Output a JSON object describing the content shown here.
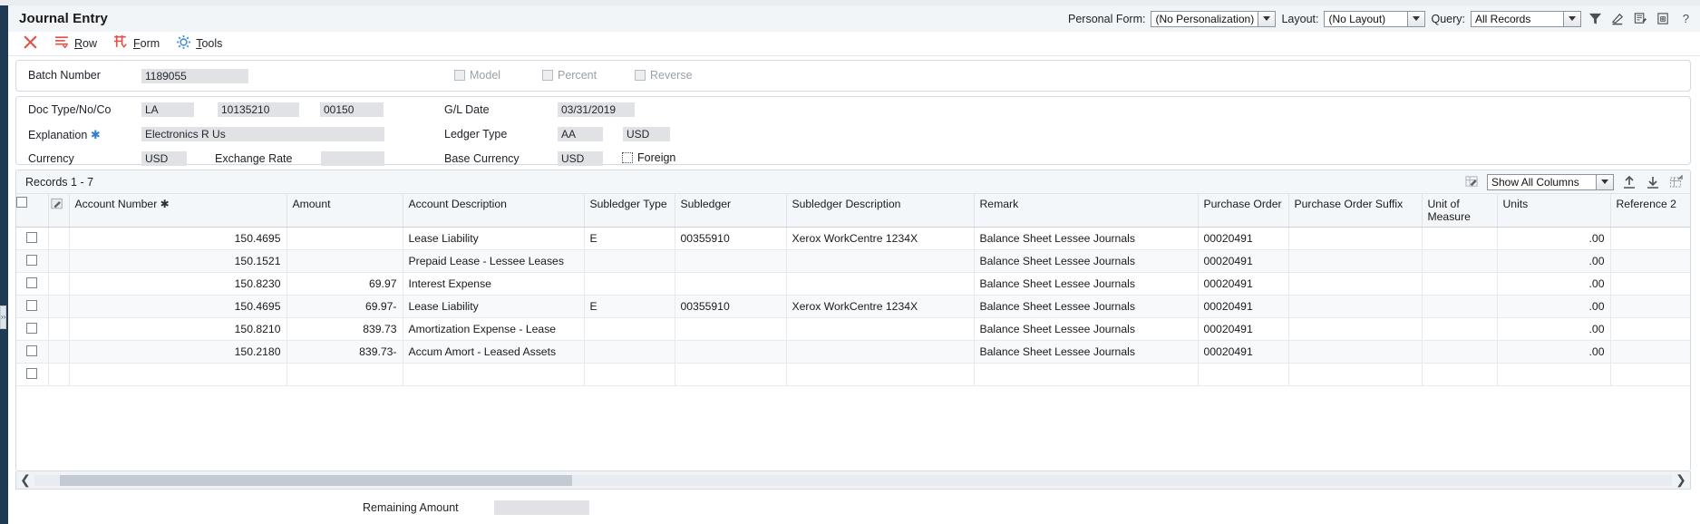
{
  "window": {
    "title": "Journal Entry"
  },
  "toolbar_right": {
    "personal_form_label": "Personal Form:",
    "personal_form_value": "(No Personalization)",
    "layout_label": "Layout:",
    "layout_value": "(No Layout)",
    "query_label": "Query:",
    "query_value": "All Records",
    "icons": [
      "filter-icon",
      "highlighter-icon",
      "form-edit-icon",
      "save-form-icon",
      "help-icon"
    ]
  },
  "actions": [
    {
      "name": "close-action",
      "label": "",
      "icon": "close-x-icon"
    },
    {
      "name": "row-action",
      "label": "Row",
      "accel": "R",
      "icon": "row-menu-icon"
    },
    {
      "name": "form-action",
      "label": "Form",
      "accel": "F",
      "icon": "form-menu-icon"
    },
    {
      "name": "tools-action",
      "label": "Tools",
      "accel": "T",
      "icon": "gear-icon"
    }
  ],
  "batch_panel": {
    "batch_number_label": "Batch Number",
    "batch_number_value": "1189055",
    "model_label": "Model",
    "percent_label": "Percent",
    "reverse_label": "Reverse"
  },
  "header_panel": {
    "doc_type_label": "Doc Type/No/Co",
    "doc_type_value": "LA",
    "doc_no_value": "10135210",
    "doc_co_value": "00150",
    "explanation_label": "Explanation",
    "explanation_value": "Electronics R Us",
    "currency_label": "Currency",
    "currency_value": "USD",
    "exchange_rate_label": "Exchange Rate",
    "exchange_rate_value": "",
    "gl_date_label": "G/L Date",
    "gl_date_value": "03/31/2019",
    "ledger_type_label": "Ledger Type",
    "ledger_type_value": "AA",
    "ledger_currency_value": "USD",
    "base_currency_label": "Base Currency",
    "base_currency_value": "USD",
    "foreign_label": "Foreign"
  },
  "grid": {
    "records_label": "Records 1 - 7",
    "show_columns_value": "Show All Columns",
    "toolbar_icons": [
      "grid-highlighter-icon",
      "upload-icon",
      "download-icon",
      "expand-grid-icon"
    ],
    "columns": [
      {
        "key": "checkbox",
        "label": ""
      },
      {
        "key": "pencil",
        "label": ""
      },
      {
        "key": "account_number",
        "label": "Account Number",
        "required": true
      },
      {
        "key": "amount",
        "label": "Amount"
      },
      {
        "key": "account_description",
        "label": "Account Description"
      },
      {
        "key": "subledger_type",
        "label": "Subledger Type"
      },
      {
        "key": "subledger",
        "label": "Subledger"
      },
      {
        "key": "subledger_description",
        "label": "Subledger Description"
      },
      {
        "key": "remark",
        "label": "Remark"
      },
      {
        "key": "purchase_order",
        "label": "Purchase Order"
      },
      {
        "key": "purchase_order_suffix",
        "label": "Purchase Order Suffix"
      },
      {
        "key": "unit_of_measure",
        "label": "Unit of Measure"
      },
      {
        "key": "units",
        "label": "Units"
      },
      {
        "key": "reference_2",
        "label": "Reference 2"
      }
    ],
    "rows": [
      {
        "account_number": "150.4695",
        "amount": "",
        "account_description": "Lease Liability",
        "subledger_type": "E",
        "subledger": "00355910",
        "subledger_description": "Xerox WorkCentre 1234X",
        "remark": "Balance Sheet Lessee Journals",
        "purchase_order": "00020491",
        "purchase_order_suffix": "",
        "unit_of_measure": "",
        "units": ".00",
        "reference_2": ""
      },
      {
        "account_number": "150.1521",
        "amount": "",
        "account_description": "Prepaid Lease - Lessee Leases",
        "subledger_type": "",
        "subledger": "",
        "subledger_description": "",
        "remark": "Balance Sheet Lessee Journals",
        "purchase_order": "00020491",
        "purchase_order_suffix": "",
        "unit_of_measure": "",
        "units": ".00",
        "reference_2": ""
      },
      {
        "account_number": "150.8230",
        "amount": "69.97",
        "account_description": "Interest Expense",
        "subledger_type": "",
        "subledger": "",
        "subledger_description": "",
        "remark": "Balance Sheet Lessee Journals",
        "purchase_order": "00020491",
        "purchase_order_suffix": "",
        "unit_of_measure": "",
        "units": ".00",
        "reference_2": ""
      },
      {
        "account_number": "150.4695",
        "amount": "69.97-",
        "account_description": "Lease Liability",
        "subledger_type": "E",
        "subledger": "00355910",
        "subledger_description": "Xerox WorkCentre 1234X",
        "remark": "Balance Sheet Lessee Journals",
        "purchase_order": "00020491",
        "purchase_order_suffix": "",
        "unit_of_measure": "",
        "units": ".00",
        "reference_2": ""
      },
      {
        "account_number": "150.8210",
        "amount": "839.73",
        "account_description": "Amortization Expense - Lease",
        "subledger_type": "",
        "subledger": "",
        "subledger_description": "",
        "remark": "Balance Sheet Lessee Journals",
        "purchase_order": "00020491",
        "purchase_order_suffix": "",
        "unit_of_measure": "",
        "units": ".00",
        "reference_2": ""
      },
      {
        "account_number": "150.2180",
        "amount": "839.73-",
        "account_description": "Accum Amort - Leased Assets",
        "subledger_type": "",
        "subledger": "",
        "subledger_description": "",
        "remark": "Balance Sheet Lessee Journals",
        "purchase_order": "00020491",
        "purchase_order_suffix": "",
        "unit_of_measure": "",
        "units": ".00",
        "reference_2": ""
      },
      {
        "account_number": "",
        "amount": "",
        "account_description": "",
        "subledger_type": "",
        "subledger": "",
        "subledger_description": "",
        "remark": "",
        "purchase_order": "",
        "purchase_order_suffix": "",
        "unit_of_measure": "",
        "units": "",
        "reference_2": ""
      }
    ]
  },
  "footer": {
    "remaining_amount_label": "Remaining Amount",
    "remaining_amount_value": ""
  },
  "colors": {
    "accent_blue": "#1f3b54",
    "required_star": "#2f7fd1",
    "action_red": "#e0524a",
    "action_blue": "#4a90d9",
    "field_bg": "#e0e2e5"
  }
}
